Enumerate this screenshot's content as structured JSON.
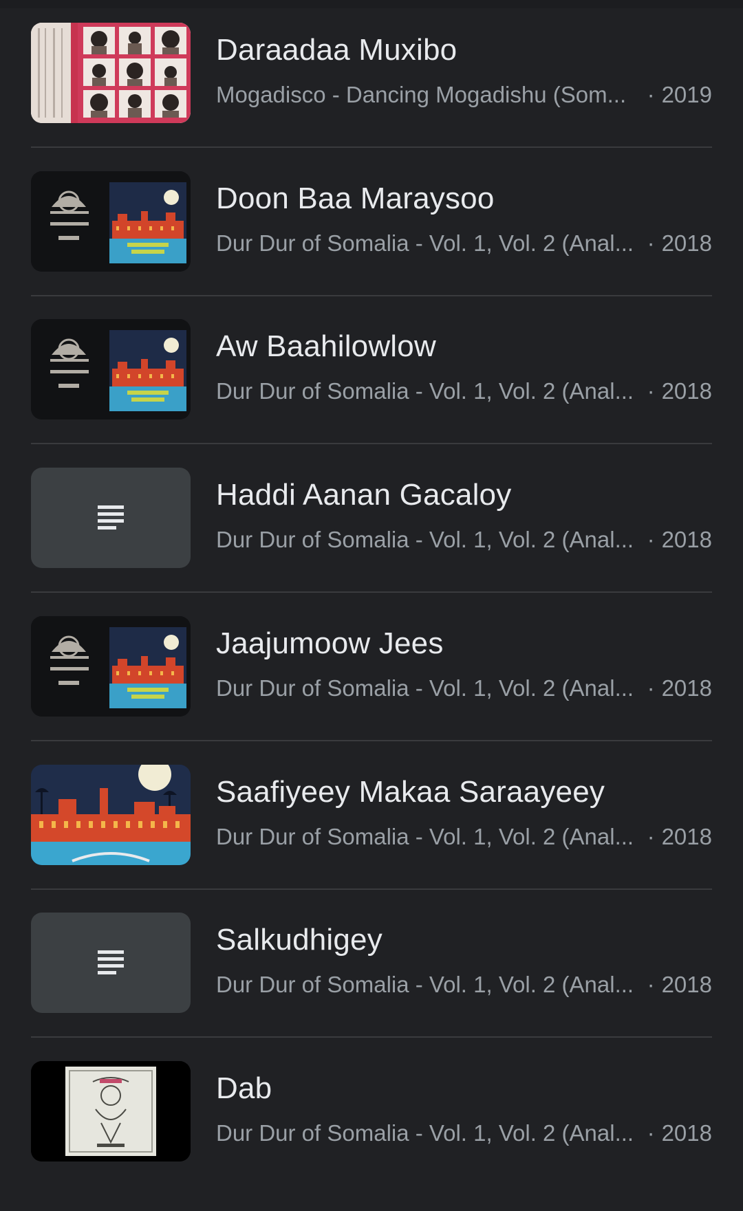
{
  "tracks": [
    {
      "title": "Daraadaa Muxibo",
      "album": "Mogadisco - Dancing Mogadishu (Som...",
      "year": "2019",
      "art": "mogadisco-cover"
    },
    {
      "title": "Doon Baa Maraysoo",
      "album": "Dur Dur of Somalia - Vol. 1, Vol. 2 (Anal...",
      "year": "2018",
      "art": "durdur-cover"
    },
    {
      "title": "Aw Baahilowlow",
      "album": "Dur Dur of Somalia - Vol. 1, Vol. 2 (Anal...",
      "year": "2018",
      "art": "durdur-cover"
    },
    {
      "title": "Haddi Aanan Gacaloy",
      "album": "Dur Dur of Somalia - Vol. 1, Vol. 2 (Anal...",
      "year": "2018",
      "art": "lyrics-placeholder-icon"
    },
    {
      "title": "Jaajumoow Jees",
      "album": "Dur Dur of Somalia - Vol. 1, Vol. 2 (Anal...",
      "year": "2018",
      "art": "durdur-cover"
    },
    {
      "title": "Saafiyeey Makaa Saraayeey",
      "album": "Dur Dur of Somalia - Vol. 1, Vol. 2 (Anal...",
      "year": "2018",
      "art": "durdur-city-cover"
    },
    {
      "title": "Salkudhigey",
      "album": "Dur Dur of Somalia - Vol. 1, Vol. 2 (Anal...",
      "year": "2018",
      "art": "lyrics-placeholder-icon"
    },
    {
      "title": "Dab",
      "album": "Dur Dur of Somalia - Vol. 1, Vol. 2 (Anal...",
      "year": "2018",
      "art": "durdur-sketch-cover"
    }
  ],
  "separator": "·",
  "colors": {
    "background": "#202124",
    "title": "#e8eaed",
    "subtitle": "#9aa0a6",
    "divider": "#3a3b3e",
    "placeholder": "#3c4043"
  }
}
